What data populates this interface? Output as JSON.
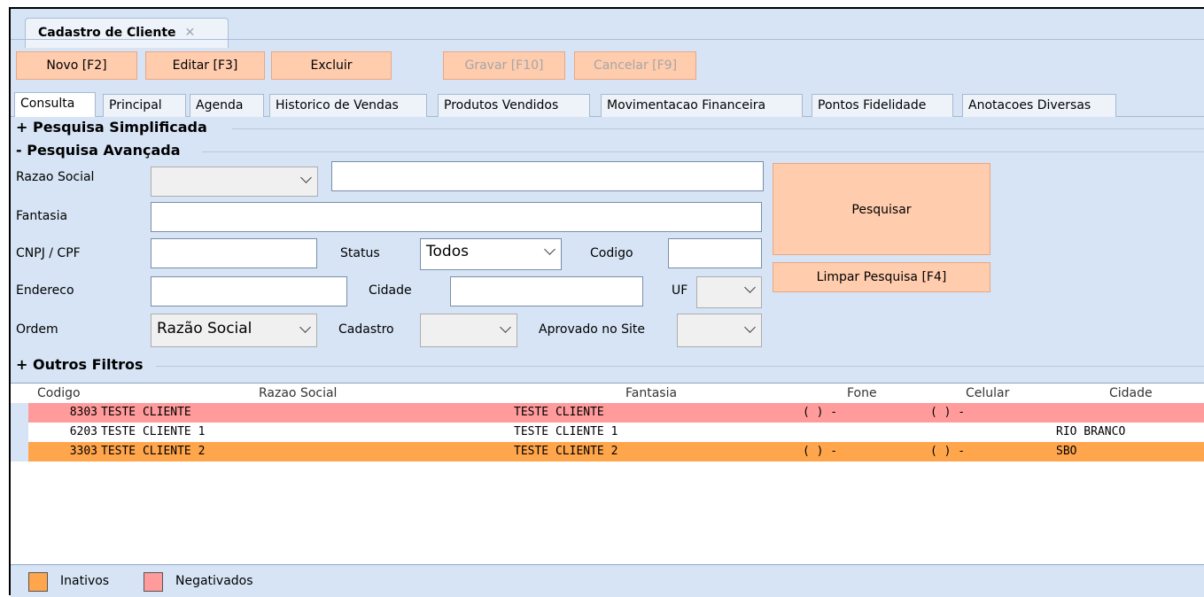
{
  "window": {
    "tab_title": "Cadastro de Cliente",
    "tab_close": "✕"
  },
  "toolbar": {
    "novo": "Novo [F2]",
    "editar": "Editar [F3]",
    "excluir": "Excluir",
    "gravar": "Gravar [F10]",
    "cancelar": "Cancelar [F9]"
  },
  "tabs": [
    "Consulta",
    "Principal",
    "Agenda",
    "Historico de Vendas",
    "Produtos Vendidos",
    "Movimentacao Financeira",
    "Pontos Fidelidade",
    "Anotacoes Diversas"
  ],
  "sections": {
    "simplificada": "+ Pesquisa Simplificada",
    "avancada": "- Pesquisa Avançada",
    "outros": "+ Outros Filtros"
  },
  "form": {
    "razao_social_label": "Razao Social",
    "fantasia_label": "Fantasia",
    "cnpj_label": "CNPJ / CPF",
    "status_label": "Status",
    "status_value": "Todos",
    "codigo_label": "Codigo",
    "endereco_label": "Endereco",
    "cidade_label": "Cidade",
    "uf_label": "UF",
    "ordem_label": "Ordem",
    "ordem_value": "Razão Social",
    "cadastro_label": "Cadastro",
    "aprovado_label": "Aprovado no Site",
    "pesquisar": "Pesquisar",
    "limpar": "Limpar Pesquisa [F4]"
  },
  "grid": {
    "columns": [
      "Codigo",
      "Razao Social",
      "Fantasia",
      "Fone",
      "Celular",
      "Cidade"
    ],
    "rows": [
      {
        "codigo": "8303",
        "razao": "TESTE CLIENTE",
        "fantasia": "TESTE CLIENTE",
        "fone": "( )  -",
        "celular": "( )  -",
        "cidade": "",
        "status": "negativado"
      },
      {
        "codigo": "6203",
        "razao": "TESTE CLIENTE 1",
        "fantasia": "TESTE CLIENTE 1",
        "fone": "",
        "celular": "",
        "cidade": "RIO BRANCO",
        "status": "normal"
      },
      {
        "codigo": "3303",
        "razao": "TESTE CLIENTE 2",
        "fantasia": "TESTE CLIENTE 2",
        "fone": "( )  -",
        "celular": "( )  -",
        "cidade": "SBO",
        "status": "inativo"
      }
    ]
  },
  "legend": {
    "inativos": "Inativos",
    "negativados": "Negativados"
  },
  "colors": {
    "inativo": "#ffa64d",
    "negativado": "#ff9b9b",
    "button": "#ffccad",
    "background": "#d6e4f5"
  }
}
